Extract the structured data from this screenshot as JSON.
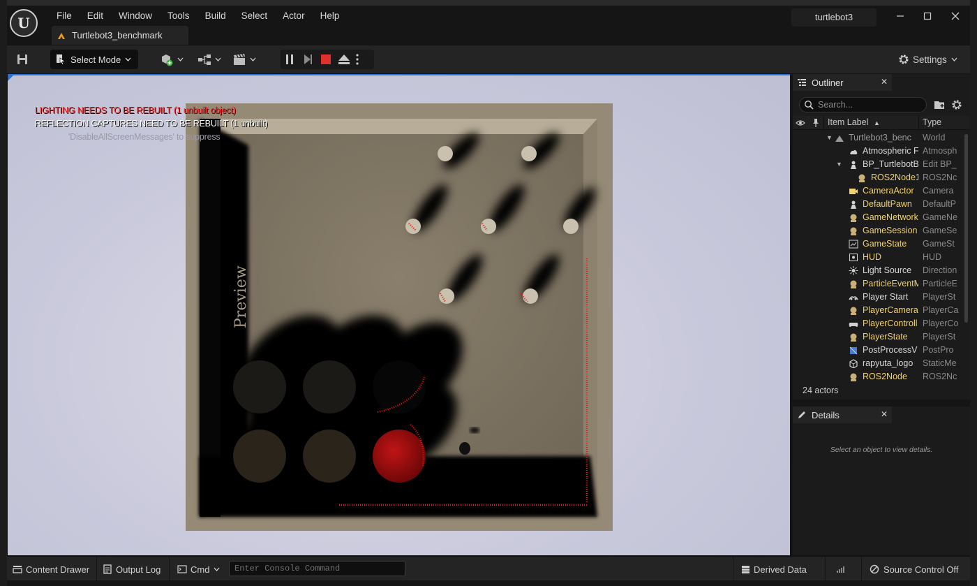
{
  "window": {
    "project_name": "turtlebot3",
    "minimize": "—",
    "maximize": "☐",
    "close": "✕"
  },
  "menu": [
    "File",
    "Edit",
    "Window",
    "Tools",
    "Build",
    "Select",
    "Actor",
    "Help"
  ],
  "level_tab": {
    "label": "Turtlebot3_benchmark"
  },
  "toolbar": {
    "select_mode": "Select Mode",
    "settings": "Settings"
  },
  "viewport": {
    "msg_lighting": "LIGHTING NEEDS TO BE REBUILT (1 unbuilt object)",
    "msg_reflection": "REFLECTION CAPTURES NEED TO BE REBUILT (1 unbuilt)",
    "msg_disable": "'DisableAllScreenMessages' to suppress",
    "watermark": "Preview"
  },
  "outliner": {
    "tab": "Outliner",
    "search_placeholder": "Search...",
    "col_label": "Item Label",
    "col_sort_indicator": "▲",
    "col_type": "Type",
    "rows": [
      {
        "label": "Turtlebot3_benc",
        "type": "World",
        "icon": "world-icon",
        "color": "grey"
      },
      {
        "label": "Atmospheric F",
        "type": "Atmosph",
        "icon": "sky-icon",
        "color": "white"
      },
      {
        "label": "BP_TurtlebotB",
        "type": "Edit BP_",
        "icon": "pawn-icon",
        "color": "white"
      },
      {
        "label": "ROS2Node1",
        "type": "ROS2Nc",
        "icon": "actor-icon",
        "color": "yellow"
      },
      {
        "label": "CameraActor",
        "type": "Camera",
        "icon": "camera-icon",
        "color": "yellow"
      },
      {
        "label": "DefaultPawn",
        "type": "DefaultP",
        "icon": "pawn-icon",
        "color": "yellow"
      },
      {
        "label": "GameNetwork",
        "type": "GameNe",
        "icon": "actor-icon",
        "color": "yellow"
      },
      {
        "label": "GameSession",
        "type": "GameSe",
        "icon": "actor-icon",
        "color": "yellow"
      },
      {
        "label": "GameState",
        "type": "GameSt",
        "icon": "chart-icon",
        "color": "yellow"
      },
      {
        "label": "HUD",
        "type": "HUD",
        "icon": "hud-icon",
        "color": "yellow"
      },
      {
        "label": "Light Source",
        "type": "Direction",
        "icon": "sun-icon",
        "color": "white"
      },
      {
        "label": "ParticleEventM",
        "type": "ParticleE",
        "icon": "actor-icon",
        "color": "yellow"
      },
      {
        "label": "Player Start",
        "type": "PlayerSt",
        "icon": "player-start-icon",
        "color": "white"
      },
      {
        "label": "PlayerCamera",
        "type": "PlayerCa",
        "icon": "actor-icon",
        "color": "yellow"
      },
      {
        "label": "PlayerControll",
        "type": "PlayerCo",
        "icon": "gamepad-icon",
        "color": "yellow"
      },
      {
        "label": "PlayerState",
        "type": "PlayerSt",
        "icon": "actor-icon",
        "color": "yellow"
      },
      {
        "label": "PostProcessV",
        "type": "PostPro",
        "icon": "postprocess-icon",
        "color": "white"
      },
      {
        "label": "rapyuta_logo",
        "type": "StaticMe",
        "icon": "mesh-icon",
        "color": "white"
      },
      {
        "label": "ROS2Node",
        "type": "ROS2Nc",
        "icon": "actor-icon",
        "color": "yellow"
      }
    ],
    "actor_count": "24 actors"
  },
  "details": {
    "tab": "Details",
    "empty_text": "Select an object to view details."
  },
  "bottombar": {
    "content_drawer": "Content Drawer",
    "output_log": "Output Log",
    "cmd": "Cmd",
    "console_placeholder": "Enter Console Command",
    "derived_data": "Derived Data",
    "source_control": "Source Control Off"
  },
  "colors": {
    "accent": "#2a6fd6",
    "stop_red": "#e0302b",
    "warning_red": "#ff2a2a",
    "actor_yellow": "#f2d26b"
  }
}
